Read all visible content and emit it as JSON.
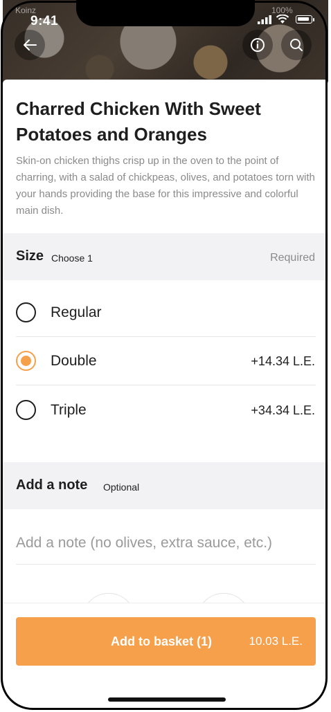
{
  "status_bar": {
    "time": "9:41",
    "carrier": "Koinz",
    "battery_percent": "100%"
  },
  "nav": {
    "back_icon": "arrow-left-icon",
    "info_icon": "info-icon",
    "search_icon": "search-icon"
  },
  "dish": {
    "title": "Charred Chicken With Sweet Potatoes and Oranges",
    "description": "Skin-on chicken thighs crisp up in the oven to the point of charring, with a salad of chickpeas, olives, and potatoes torn with your hands providing the base for this impressive and colorful main dish."
  },
  "size_section": {
    "title": "Size",
    "subtitle": "Choose 1",
    "required_label": "Required",
    "options": [
      {
        "label": "Regular",
        "price": "",
        "selected": false
      },
      {
        "label": "Double",
        "price": "+14.34  L.E.",
        "selected": true
      },
      {
        "label": "Triple",
        "price": "+34.34  L.E.",
        "selected": false
      }
    ]
  },
  "note_section": {
    "title": "Add a note",
    "subtitle": "Optional",
    "placeholder": "Add a note (no olives, extra sauce, etc.)"
  },
  "footer": {
    "add_label": "Add to basket (1)",
    "total": "10.03 L.E."
  },
  "colors": {
    "accent": "#f7a04b",
    "text": "#1e1e1e",
    "muted": "#8a8a8a",
    "section_bg": "#f2f2f4"
  }
}
